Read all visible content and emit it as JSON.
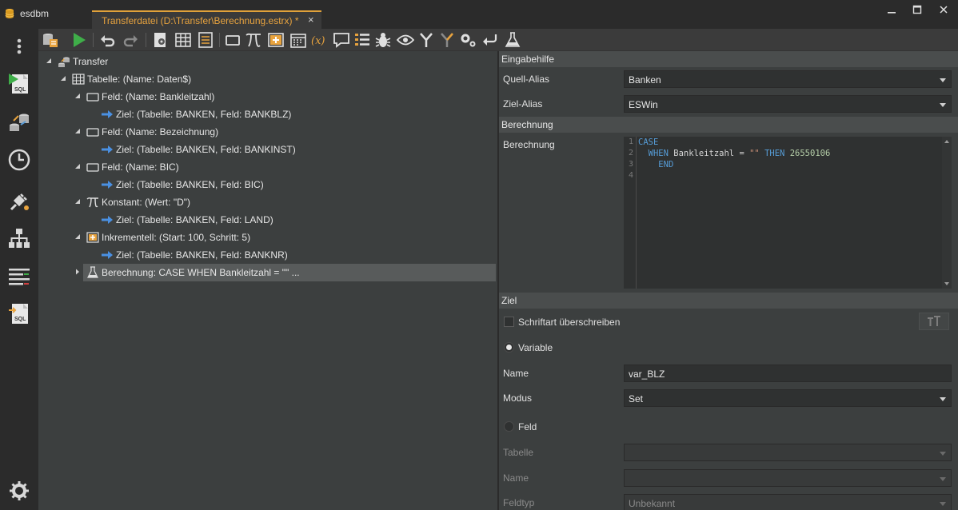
{
  "app": {
    "name": "esdbm"
  },
  "tab": {
    "title": "Transferdatei (D:\\Transfer\\Berechnung.estrx) *",
    "close": "×"
  },
  "window": {
    "minimize": "▬",
    "maximize": "☐",
    "close": "✕"
  },
  "rail": [
    "menu-icon",
    "sql-run-icon",
    "transfer-icon",
    "history-icon",
    "connection-icon",
    "hierarchy-icon",
    "compare-icon",
    "sql-import-icon",
    "settings-icon"
  ],
  "toolbar": [
    "database-list-icon",
    "run-icon",
    "undo-icon",
    "redo-icon",
    "table-settings-icon",
    "table-icon",
    "list-icon",
    "field-icon",
    "constant-icon",
    "increment-icon",
    "calendar-icon",
    "variable-icon",
    "comment-icon",
    "properties-icon",
    "debug-icon",
    "preview-icon",
    "merge-icon",
    "merge-alt-icon",
    "options-icon",
    "return-icon",
    "test-icon"
  ],
  "tree": {
    "root": "Transfer",
    "table": "Tabelle: (Name: Daten$)",
    "nodes": [
      {
        "label": "Feld: (Name: Bankleitzahl)",
        "target": "Ziel: (Tabelle: BANKEN, Feld: BANKBLZ)"
      },
      {
        "label": "Feld: (Name: Bezeichnung)",
        "target": "Ziel: (Tabelle: BANKEN, Feld: BANKINST)"
      },
      {
        "label": "Feld: (Name: BIC)",
        "target": "Ziel: (Tabelle: BANKEN, Feld: BIC)"
      },
      {
        "label": "Konstant: (Wert: \"D\")",
        "target": "Ziel: (Tabelle: BANKEN, Feld: LAND)"
      },
      {
        "label": "Inkrementell: (Start: 100, Schritt: 5)",
        "target": "Ziel: (Tabelle: BANKEN, Feld: BANKNR)"
      }
    ],
    "selected": "Berechnung: CASE  WHEN Bankleitzahl = \"\" ..."
  },
  "props": {
    "sec_input": "Eingabehilfe",
    "source_alias_label": "Quell-Alias",
    "source_alias_value": "Banken",
    "target_alias_label": "Ziel-Alias",
    "target_alias_value": "ESWin",
    "sec_calc": "Berechnung",
    "calc_label": "Berechnung",
    "code_lines": [
      "1",
      "2",
      "3",
      "4"
    ],
    "code": {
      "l1_kw": "CASE",
      "l2_kw1": "WHEN",
      "l2_txt": " Bankleitzahl = ",
      "l2_str": "\"\"",
      "l2_kw2": "THEN",
      "l2_num": "26550106",
      "l3_kw": "END"
    },
    "sec_target": "Ziel",
    "override_font_label": "Schriftart überschreiben",
    "font_button": "ꟸT",
    "variable_label": "Variable",
    "name_label": "Name",
    "name_value": "var_BLZ",
    "mode_label": "Modus",
    "mode_value": "Set",
    "field_label": "Feld",
    "table_label": "Tabelle",
    "table_value": "",
    "name2_label": "Name",
    "name2_value": "",
    "fieldtype_label": "Feldtyp",
    "fieldtype_value": "Unbekannt"
  }
}
